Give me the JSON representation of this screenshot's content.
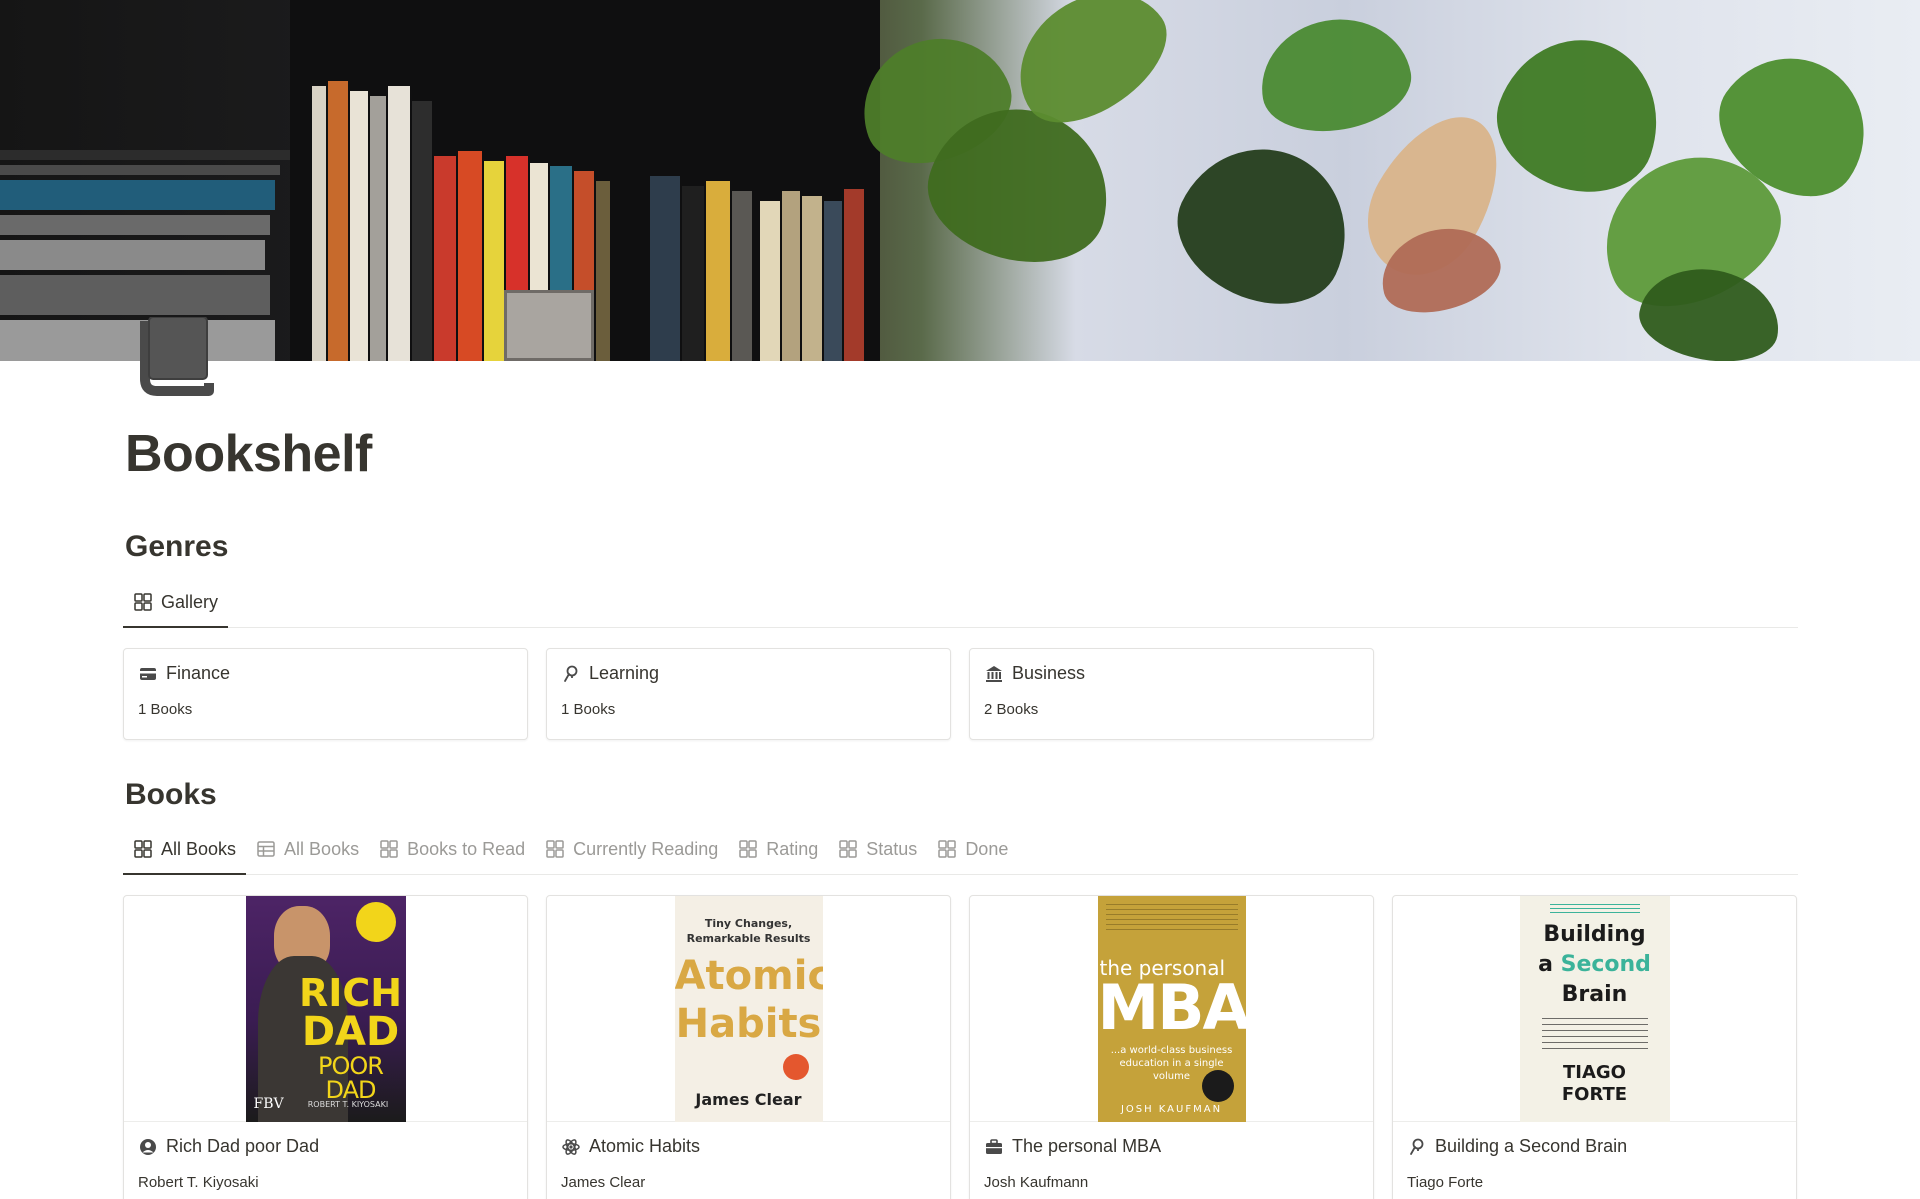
{
  "page": {
    "title": "Bookshelf",
    "icon": "book-icon"
  },
  "genres": {
    "title": "Genres",
    "tabs": [
      {
        "label": "Gallery",
        "icon": "gallery-icon",
        "active": true
      }
    ],
    "cards": [
      {
        "name": "Finance",
        "icon": "credit-card-icon",
        "count": "1 Books"
      },
      {
        "name": "Learning",
        "icon": "pin-icon",
        "count": "1 Books"
      },
      {
        "name": "Business",
        "icon": "bank-icon",
        "count": "2 Books"
      }
    ]
  },
  "books": {
    "title": "Books",
    "tabs": [
      {
        "label": "All Books",
        "icon": "gallery-icon",
        "active": true
      },
      {
        "label": "All Books",
        "icon": "table-icon",
        "active": false
      },
      {
        "label": "Books to Read",
        "icon": "gallery-icon",
        "active": false
      },
      {
        "label": "Currently Reading",
        "icon": "gallery-icon",
        "active": false
      },
      {
        "label": "Rating",
        "icon": "gallery-icon",
        "active": false
      },
      {
        "label": "Status",
        "icon": "gallery-icon",
        "active": false
      },
      {
        "label": "Done",
        "icon": "gallery-icon",
        "active": false
      }
    ],
    "cards": [
      {
        "title": "Rich Dad poor Dad",
        "author": "Robert T. Kiyosaki",
        "icon": "person-circle-icon",
        "cover": {
          "line1": "RICH",
          "line2": "DAD",
          "line3": "POOR DAD",
          "badge": "FBV",
          "credit": "ROBERT T. KIYOSAKI"
        }
      },
      {
        "title": "Atomic Habits",
        "author": "James Clear",
        "icon": "atom-icon",
        "cover": {
          "tagline": "Tiny Changes,\nRemarkable Results",
          "line1": "Atomic",
          "line2": "Habits",
          "credit": "James Clear"
        }
      },
      {
        "title": "The personal MBA",
        "author": "Josh Kaufmann",
        "icon": "briefcase-icon",
        "cover": {
          "line1": "the personal",
          "line2": "MBA",
          "sub": "...a world-class business education in a single volume",
          "credit": "JOSH KAUFMAN"
        }
      },
      {
        "title": "Building a Second Brain",
        "author": "Tiago Forte",
        "icon": "pin-icon",
        "cover": {
          "line1": "Building",
          "line2a": "a",
          "line2b": "Second",
          "line3": "Brain",
          "credit1": "TIAGO",
          "credit2": "FORTE"
        }
      }
    ]
  }
}
